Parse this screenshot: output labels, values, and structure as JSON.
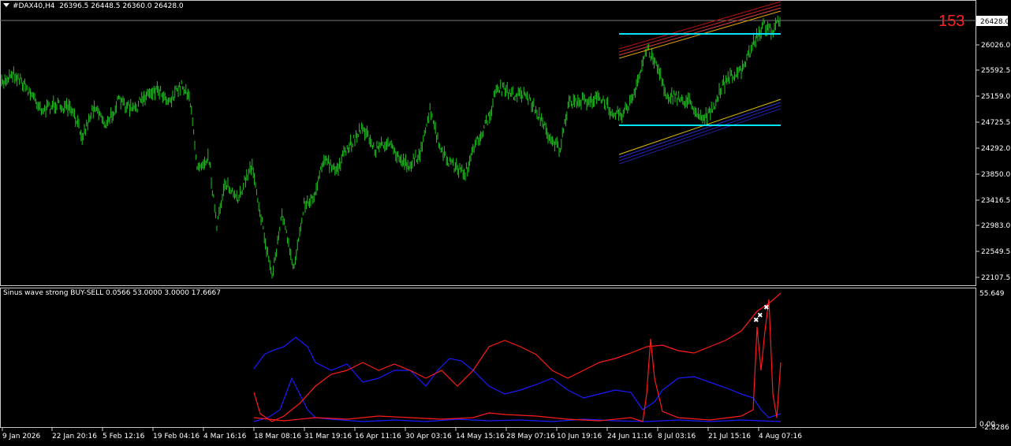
{
  "main_chart": {
    "symbol_label": "#DAX40,H4",
    "ohlc": "26396.5 26448.5 26360.0 26428.0",
    "current_price": "26428.0",
    "counter": "153",
    "price_ticks": [
      "26026.0",
      "25592.5",
      "25159.0",
      "24725.5",
      "24292.0",
      "23850.0",
      "23416.5",
      "22983.0",
      "22549.5",
      "22107.5"
    ],
    "colors": {
      "candles": "#1fc21f",
      "levels": "#00e5ff"
    }
  },
  "indicator": {
    "label": "Sinus wave strong BUY-SELL 0.0566 53.0000 3.0000 17.6667",
    "ticks": [
      "55.649",
      "0.00",
      "-2.8286"
    ],
    "colors": {
      "buy": "#ff1a1a",
      "sell": "#1a1aff"
    }
  },
  "time_axis": [
    "9 Jan 2026",
    "22 Jan 20:16",
    "5 Feb 12:16",
    "19 Feb 04:16",
    "4 Mar 16:16",
    "18 Mar 08:16",
    "31 Mar 19:16",
    "16 Apr 11:16",
    "30 Apr 03:16",
    "14 May 15:16",
    "28 May 07:16",
    "10 Jun 19:16",
    "24 Jun 11:16",
    "8 Jul 03:16",
    "21 Jul 15:16",
    "4 Aug 07:16"
  ]
}
